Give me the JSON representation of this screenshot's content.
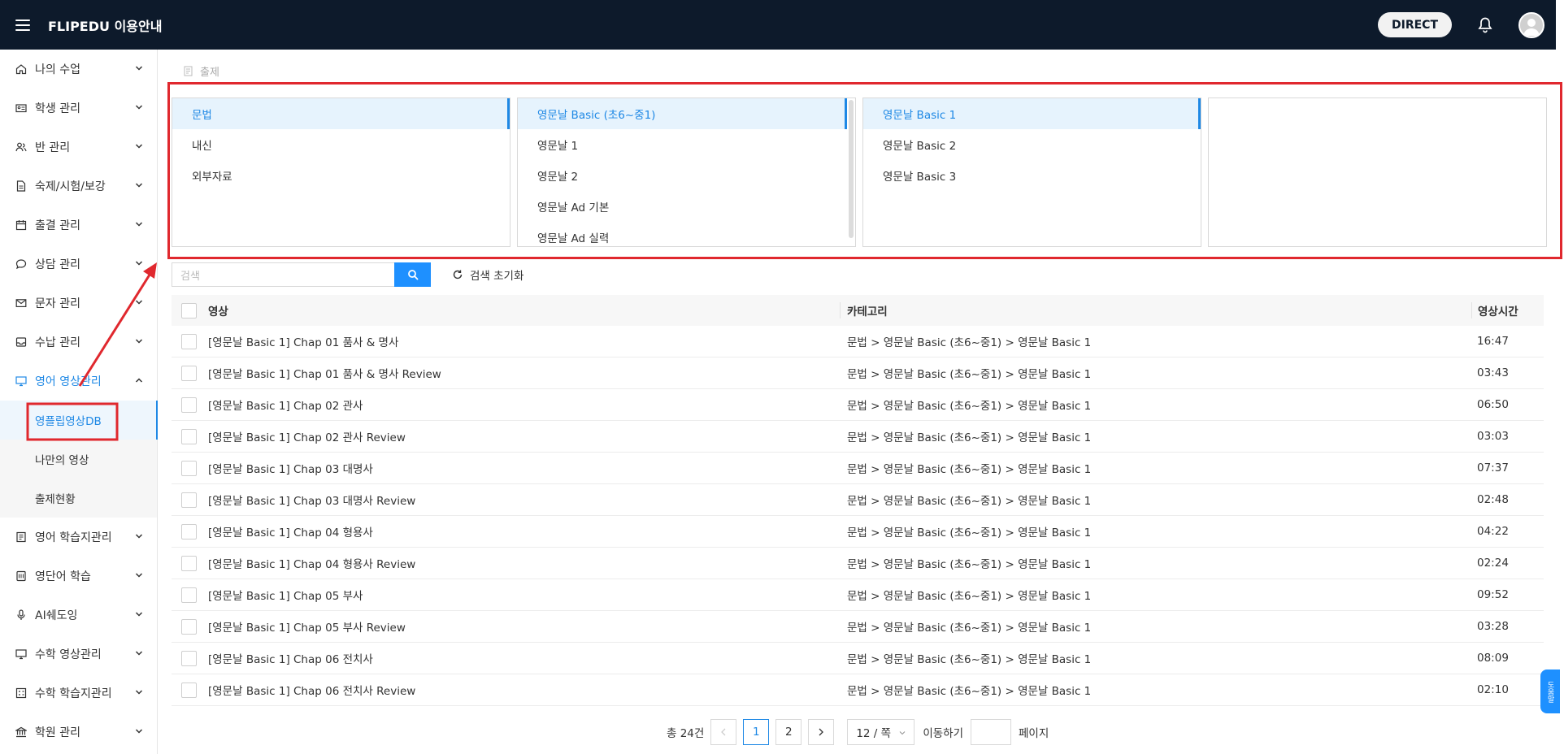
{
  "header": {
    "brand": "FLIPEDU 이용안내",
    "direct_label": "DIRECT"
  },
  "sidebar": {
    "items": [
      {
        "label": "나의 수업",
        "icon": "home-icon"
      },
      {
        "label": "학생 관리",
        "icon": "id-card-icon"
      },
      {
        "label": "반 관리",
        "icon": "users-icon"
      },
      {
        "label": "숙제/시험/보강",
        "icon": "document-icon"
      },
      {
        "label": "출결 관리",
        "icon": "calendar-icon"
      },
      {
        "label": "상담 관리",
        "icon": "chat-icon"
      },
      {
        "label": "문자 관리",
        "icon": "mail-icon"
      },
      {
        "label": "수납 관리",
        "icon": "inbox-icon"
      },
      {
        "label": "영어 영상관리",
        "icon": "monitor-icon"
      }
    ],
    "sub_items": [
      {
        "label": "영플립영상DB"
      },
      {
        "label": "나만의 영상"
      },
      {
        "label": "출제현황"
      }
    ],
    "items_after": [
      {
        "label": "영어 학습지관리",
        "icon": "notebook-icon"
      },
      {
        "label": "영단어 학습",
        "icon": "book-icon"
      },
      {
        "label": "AI쉐도잉",
        "icon": "mic-icon"
      },
      {
        "label": "수학 영상관리",
        "icon": "monitor-icon"
      },
      {
        "label": "수학 학습지관리",
        "icon": "grid-icon"
      },
      {
        "label": "학원 관리",
        "icon": "bank-icon"
      }
    ]
  },
  "breadcrumb": {
    "label": "출제"
  },
  "panels": {
    "col1": [
      "문법",
      "내신",
      "외부자료"
    ],
    "col2": [
      "영문날 Basic (초6~중1)",
      "영문날 1",
      "영문날 2",
      "영문날 Ad 기본",
      "영문날 Ad 실력"
    ],
    "col3": [
      "영문날 Basic 1",
      "영문날 Basic 2",
      "영문날 Basic 3"
    ],
    "col4": []
  },
  "search": {
    "placeholder": "검색",
    "reset_label": "검색 초기화"
  },
  "table": {
    "headers": {
      "video": "영상",
      "category": "카테고리",
      "duration": "영상시간"
    },
    "rows": [
      {
        "video": "[영문날 Basic 1] Chap 01 품사 & 명사",
        "category": "문법 > 영문날 Basic (초6~중1) > 영문날 Basic 1",
        "duration": "16:47"
      },
      {
        "video": "[영문날 Basic 1] Chap 01 품사 & 명사 Review",
        "category": "문법 > 영문날 Basic (초6~중1) > 영문날 Basic 1",
        "duration": "03:43"
      },
      {
        "video": "[영문날 Basic 1] Chap 02 관사",
        "category": "문법 > 영문날 Basic (초6~중1) > 영문날 Basic 1",
        "duration": "06:50"
      },
      {
        "video": "[영문날 Basic 1] Chap 02 관사 Review",
        "category": "문법 > 영문날 Basic (초6~중1) > 영문날 Basic 1",
        "duration": "03:03"
      },
      {
        "video": "[영문날 Basic 1] Chap 03 대명사",
        "category": "문법 > 영문날 Basic (초6~중1) > 영문날 Basic 1",
        "duration": "07:37"
      },
      {
        "video": "[영문날 Basic 1] Chap 03 대명사 Review",
        "category": "문법 > 영문날 Basic (초6~중1) > 영문날 Basic 1",
        "duration": "02:48"
      },
      {
        "video": "[영문날 Basic 1] Chap 04 형용사",
        "category": "문법 > 영문날 Basic (초6~중1) > 영문날 Basic 1",
        "duration": "04:22"
      },
      {
        "video": "[영문날 Basic 1] Chap 04 형용사 Review",
        "category": "문법 > 영문날 Basic (초6~중1) > 영문날 Basic 1",
        "duration": "02:24"
      },
      {
        "video": "[영문날 Basic 1] Chap 05 부사",
        "category": "문법 > 영문날 Basic (초6~중1) > 영문날 Basic 1",
        "duration": "09:52"
      },
      {
        "video": "[영문날 Basic 1] Chap 05 부사 Review",
        "category": "문법 > 영문날 Basic (초6~중1) > 영문날 Basic 1",
        "duration": "03:28"
      },
      {
        "video": "[영문날 Basic 1] Chap 06 전치사",
        "category": "문법 > 영문날 Basic (초6~중1) > 영문날 Basic 1",
        "duration": "08:09"
      },
      {
        "video": "[영문날 Basic 1] Chap 06 전치사 Review",
        "category": "문법 > 영문날 Basic (초6~중1) > 영문날 Basic 1",
        "duration": "02:10"
      }
    ]
  },
  "pagination": {
    "total_label": "총 24건",
    "pages": [
      "1",
      "2"
    ],
    "current": "1",
    "page_size": "12 / 쪽",
    "goto_label": "이동하기",
    "page_suffix": "페이지"
  },
  "float_help": {
    "label": "도움말"
  },
  "colors": {
    "accent": "#1e88e5",
    "header_bg": "#0d1a2b",
    "annotation_red": "#e0282e"
  }
}
